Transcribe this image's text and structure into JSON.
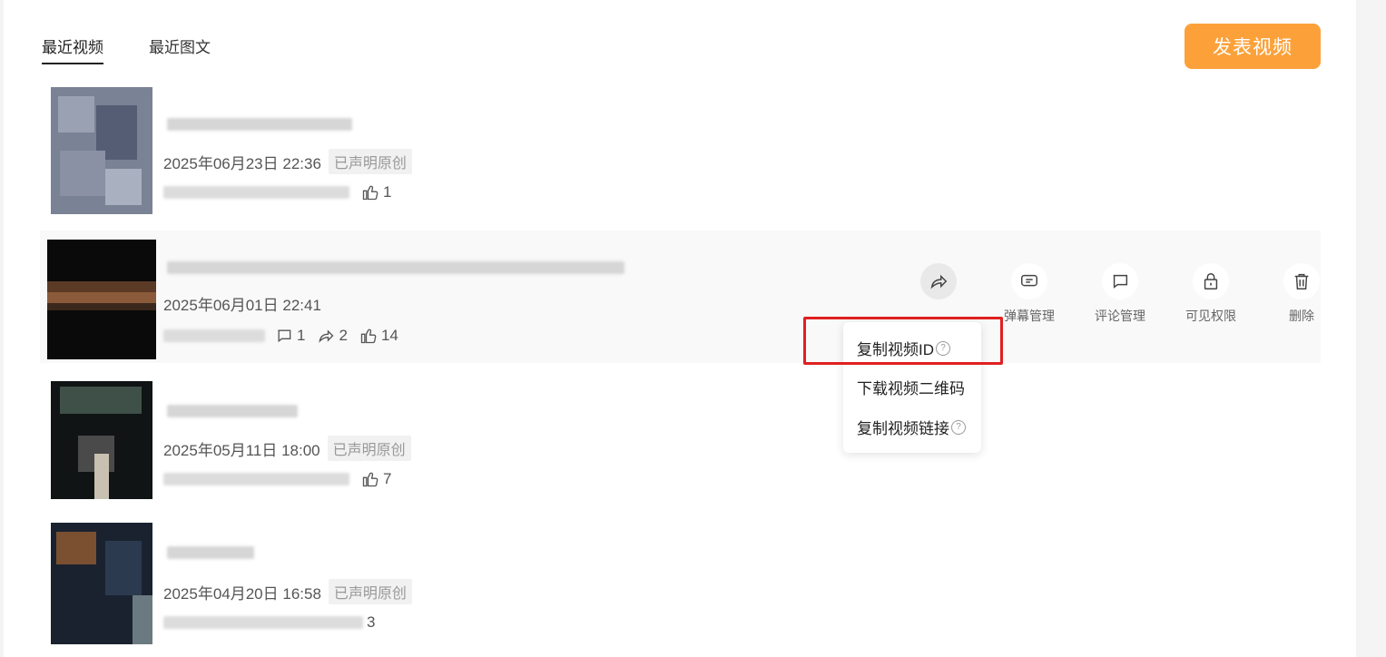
{
  "tabs": [
    {
      "label": "最近视频",
      "active": true
    },
    {
      "label": "最近图文",
      "active": false
    }
  ],
  "publish_button": "发表视频",
  "accent_color": "#fca13a",
  "videos": [
    {
      "date": "2025年06月23日 22:36",
      "original_badge": "已声明原创",
      "likes": "1"
    },
    {
      "date": "2025年06月01日 22:41",
      "original_badge": "",
      "comments": "1",
      "shares": "2",
      "likes": "14"
    },
    {
      "date": "2025年05月11日 18:00",
      "original_badge": "已声明原创",
      "likes": "7"
    },
    {
      "date": "2025年04月20日 16:58",
      "original_badge": "已声明原创",
      "likes": "3"
    }
  ],
  "actions": [
    {
      "label": "分享",
      "icon": "share-icon"
    },
    {
      "label": "弹幕管理",
      "icon": "danmaku-icon"
    },
    {
      "label": "评论管理",
      "icon": "comment-icon"
    },
    {
      "label": "可见权限",
      "icon": "lock-icon"
    },
    {
      "label": "删除",
      "icon": "trash-icon"
    }
  ],
  "share_menu": {
    "copy_id": "复制视频ID",
    "download_qr": "下载视频二维码",
    "copy_link": "复制视频链接",
    "help_glyph": "?"
  }
}
